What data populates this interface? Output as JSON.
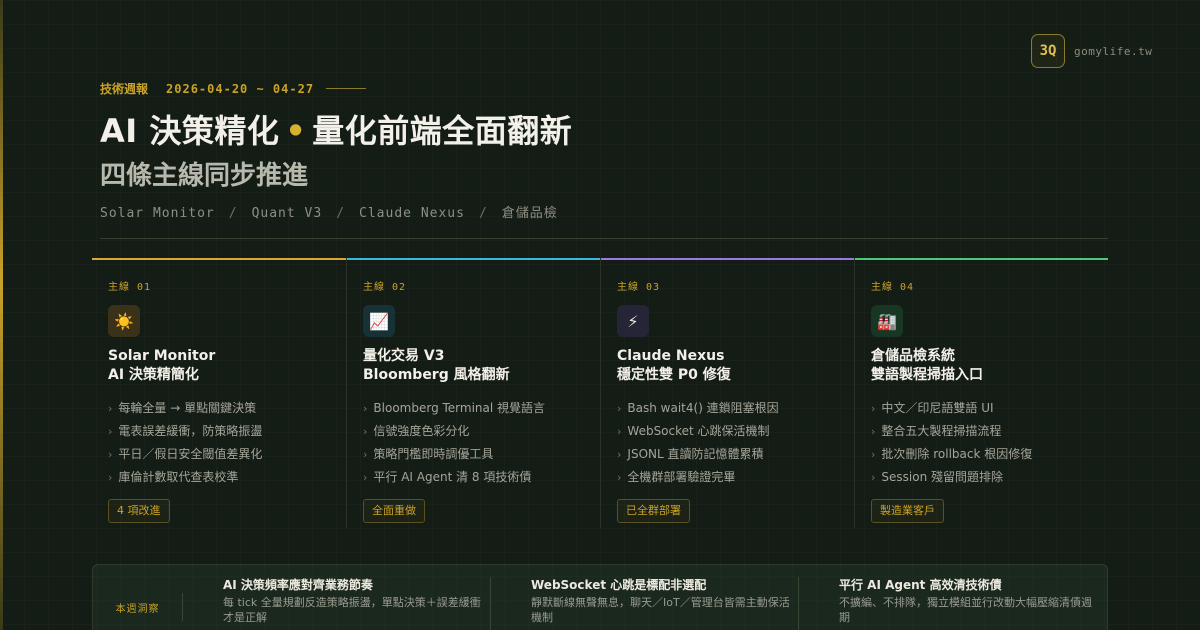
{
  "brand": {
    "logo": "3Q",
    "domain": "gomylife.tw"
  },
  "meta": {
    "label": "技術週報",
    "date_range": "2026-04-20 ~ 04-27"
  },
  "title": {
    "part1": "AI 決策精化",
    "separator": "•",
    "part2": "量化前端全面翻新"
  },
  "subtitle": "四條主線同步推進",
  "breadcrumbs": {
    "items": [
      "Solar Monitor",
      "Quant V3",
      "Claude Nexus",
      "倉儲品檢"
    ],
    "separator": "/"
  },
  "cards": [
    {
      "num": "主線 01",
      "icon": "sun-icon",
      "icon_glyph": "☀️",
      "accent": "#d9a63a",
      "title_line1": "Solar Monitor",
      "title_line2": "AI 決策精簡化",
      "items": [
        "每輪全量 → 單點關鍵決策",
        "電表誤差緩衝，防策略振盪",
        "平日／假日安全閾值差異化",
        "庫倫計數取代查表校準"
      ],
      "tag": "4 項改進"
    },
    {
      "num": "主線 02",
      "icon": "chart-up-icon",
      "icon_glyph": "📈",
      "accent": "#3fb6d8",
      "title_line1": "量化交易 V3",
      "title_line2": "Bloomberg 風格翻新",
      "items": [
        "Bloomberg Terminal 視覺語言",
        "信號強度色彩分化",
        "策略門檻即時調優工具",
        "平行 AI Agent 清 8 項技術債"
      ],
      "tag": "全面重做"
    },
    {
      "num": "主線 03",
      "icon": "lightning-icon",
      "icon_glyph": "⚡",
      "accent": "#9a7ae0",
      "title_line1": "Claude Nexus",
      "title_line2": "穩定性雙 P0 修復",
      "items": [
        "Bash wait4() 連鎖阻塞根因",
        "WebSocket 心跳保活機制",
        "JSONL 直讀防記憶體累積",
        "全機群部署驗證完畢"
      ],
      "tag": "已全群部署"
    },
    {
      "num": "主線 04",
      "icon": "factory-icon",
      "icon_glyph": "🏭",
      "accent": "#4ec97a",
      "title_line1": "倉儲品檢系統",
      "title_line2": "雙語製程掃描入口",
      "items": [
        "中文／印尼語雙語 UI",
        "整合五大製程掃描流程",
        "批次刪除 rollback 根因修復",
        "Session 殘留問題排除"
      ],
      "tag": "製造業客戶"
    }
  ],
  "insight": {
    "label": "本週洞察",
    "items": [
      {
        "title": "AI 決策頻率應對齊業務節奏",
        "desc": "每 tick 全量規劃反造策略振盪，單點決策＋誤差緩衝才是正解"
      },
      {
        "title": "WebSocket 心跳是標配非選配",
        "desc": "靜默斷線無聲無息，聊天／IoT／管理台皆需主動保活機制"
      },
      {
        "title": "平行 AI Agent 高效清技術債",
        "desc": "不擴編、不排隊，獨立模組並行改動大幅壓縮清債週期"
      }
    ]
  }
}
